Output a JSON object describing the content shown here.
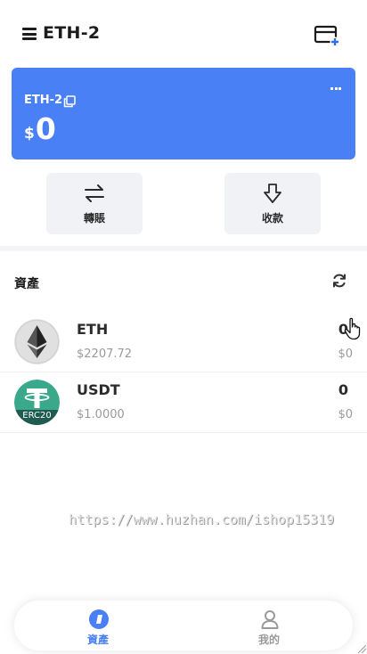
{
  "header": {
    "wallet_name": "ETH-2",
    "menu_icon": "hamburger-menu-icon",
    "add_wallet_icon": "add-wallet-card-icon"
  },
  "card": {
    "wallet_name": "ETH-2",
    "currency_symbol": "$",
    "balance": "0",
    "background_color": "#4a80f5",
    "copy_icon": "copy-icon",
    "more_icon": "more-dots-icon"
  },
  "actions": {
    "transfer_label": "轉賬",
    "receive_label": "收款",
    "transfer_icon": "swap-arrows-icon",
    "receive_icon": "download-arrow-icon"
  },
  "assets": {
    "title": "資產",
    "refresh_icon": "refresh-icon",
    "items": [
      {
        "symbol": "ETH",
        "price": "$2207.72",
        "quantity": "0",
        "value": "$0",
        "logo_icon": "ethereum-logo"
      },
      {
        "symbol": "USDT",
        "price": "$1.0000",
        "quantity": "0",
        "value": "$0",
        "logo_icon": "tether-logo",
        "logo_badge": "ERC20"
      }
    ]
  },
  "watermark": "https://www.huzhan.com/ishop15319",
  "bottom_nav": {
    "items": [
      {
        "label": "資產",
        "icon": "assets-nav-icon",
        "active": true
      },
      {
        "label": "我的",
        "icon": "profile-nav-icon",
        "active": false
      }
    ],
    "active_color": "#4a80f5",
    "inactive_color": "#9a9a9a"
  }
}
